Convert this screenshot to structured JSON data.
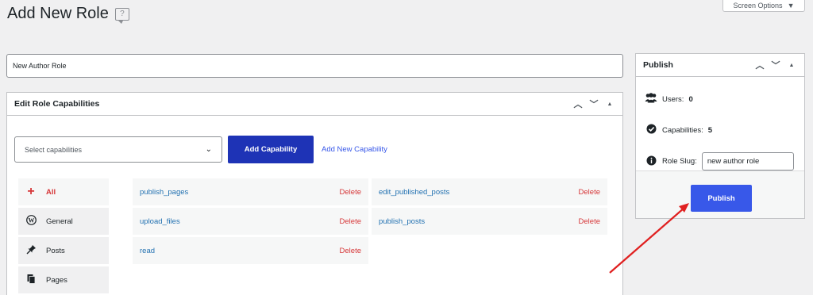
{
  "page": {
    "title": "Add New Role",
    "screen_options": "Screen Options",
    "role_name_value": "New Author Role"
  },
  "capabilities_panel": {
    "title": "Edit Role Capabilities",
    "select_placeholder": "Select capabilities",
    "add_button": "Add Capability",
    "add_new_link": "Add New Capability",
    "nav": [
      {
        "label": "All",
        "icon": "plus-icon"
      },
      {
        "label": "General",
        "icon": "wordpress-icon"
      },
      {
        "label": "Posts",
        "icon": "pin-icon"
      },
      {
        "label": "Pages",
        "icon": "pages-icon"
      }
    ],
    "capabilities": [
      {
        "name": "publish_pages",
        "delete": "Delete"
      },
      {
        "name": "edit_published_posts",
        "delete": "Delete"
      },
      {
        "name": "upload_files",
        "delete": "Delete"
      },
      {
        "name": "publish_posts",
        "delete": "Delete"
      },
      {
        "name": "read",
        "delete": "Delete"
      }
    ]
  },
  "publish_panel": {
    "title": "Publish",
    "users_label": "Users:",
    "users_count": "0",
    "capabilities_label": "Capabilities:",
    "capabilities_count": "5",
    "slug_label": "Role Slug:",
    "slug_value": "new author role",
    "publish_button": "Publish"
  },
  "colors": {
    "primary_button": "#1e33b6",
    "publish_button": "#3858e9",
    "delete": "#d63638",
    "link": "#2271b1",
    "annotation_arrow": "#e02020"
  }
}
